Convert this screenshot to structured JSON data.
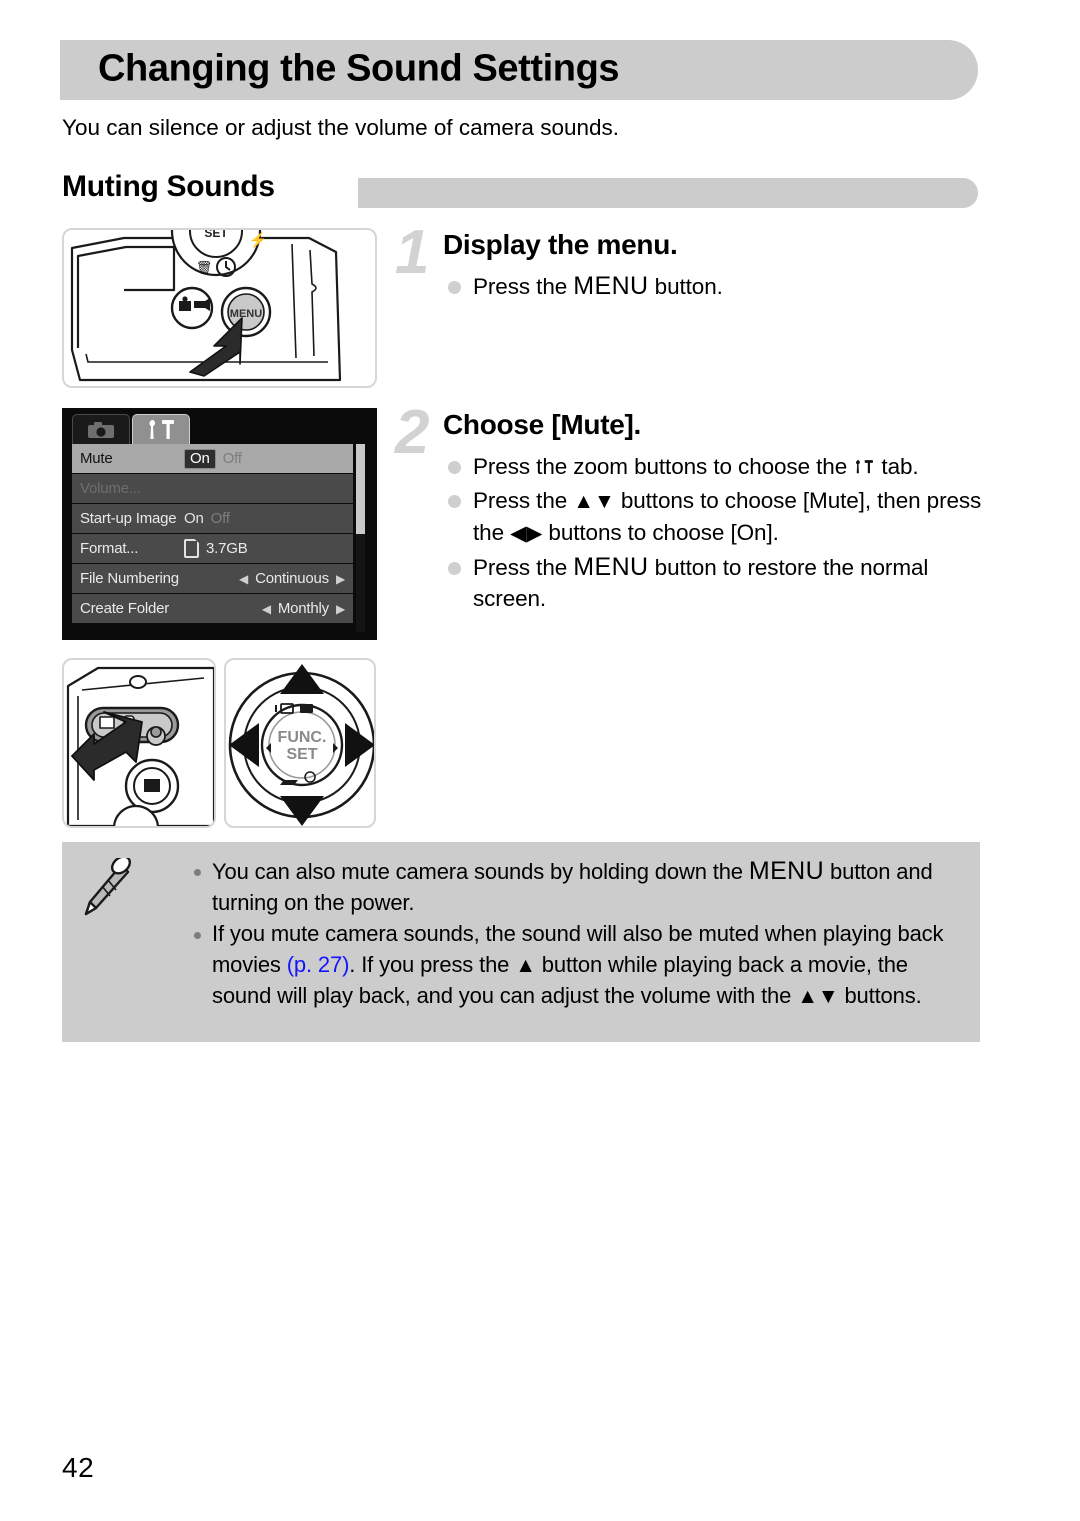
{
  "page": {
    "title": "Changing the Sound Settings",
    "intro": "You can silence or adjust the volume of camera sounds.",
    "section_heading": "Muting Sounds",
    "page_number": "42"
  },
  "steps": [
    {
      "number": "1",
      "title": "Display the menu.",
      "bullets": [
        {
          "pre": "Press the ",
          "kw": "MENU",
          "post": " button."
        }
      ]
    },
    {
      "number": "2",
      "title": "Choose [Mute].",
      "bullets": [
        {
          "pre": "Press the zoom buttons to choose the ",
          "glyph": "setup-tab-icon",
          "post": " tab."
        },
        {
          "pre": "Press the ",
          "glyph": "up-down-arrows",
          "mid": " buttons to choose [Mute], then press the ",
          "glyph2": "left-right-arrows",
          "post": " buttons to choose [On]."
        },
        {
          "pre": "Press the ",
          "kw": "MENU",
          "post": " button to restore the normal screen."
        }
      ]
    }
  ],
  "camera_menu": {
    "tabs": [
      {
        "name": "shooting-tab",
        "icon": "camera-icon",
        "active": false
      },
      {
        "name": "setup-tab",
        "icon": "wrench-hammer-icon",
        "active": true
      }
    ],
    "rows": [
      {
        "label": "Mute",
        "value_type": "onoff",
        "on": "On",
        "off": "Off",
        "selected_value": "On",
        "highlighted": true,
        "dimmed": false
      },
      {
        "label": "Volume...",
        "value_type": "none",
        "highlighted": false,
        "dimmed": true
      },
      {
        "label": "Start-up Image",
        "value_type": "onoff",
        "on": "On",
        "off": "Off",
        "selected_value": "Off",
        "highlighted": false,
        "dimmed": false
      },
      {
        "label": "Format...",
        "value_type": "card",
        "value": "3.7GB",
        "highlighted": false,
        "dimmed": false
      },
      {
        "label": "File Numbering",
        "value_type": "spin",
        "value": "Continuous",
        "highlighted": false,
        "dimmed": false
      },
      {
        "label": "Create Folder",
        "value_type": "spin",
        "value": "Monthly",
        "highlighted": false,
        "dimmed": false
      }
    ]
  },
  "figures": [
    {
      "name": "camera-menu-button-illustration",
      "caption": ""
    },
    {
      "name": "zoom-lever-illustration",
      "caption": ""
    },
    {
      "name": "func-set-control-pad-illustration",
      "label": "FUNC. SET"
    }
  ],
  "note": {
    "icon": "pencil-icon",
    "items": [
      {
        "pre": "You can also mute camera sounds by holding down the ",
        "kw": "MENU",
        "post": " button and turning on the power."
      },
      {
        "pre": "If you mute camera sounds, the sound will also be muted when playing back movies ",
        "link": "(p. 27)",
        "mid": ". If you press the ",
        "glyph": "up-arrow",
        "mid2": " button while playing back a movie, the sound will play back, and you can adjust the volume with the ",
        "glyph2": "up-down-arrows",
        "post": " buttons."
      }
    ]
  },
  "colors": {
    "bar_gray": "#cccccc",
    "note_bg": "#cccccc",
    "link_blue": "#1414ff",
    "step_number_gray": "#d2d2d2"
  }
}
